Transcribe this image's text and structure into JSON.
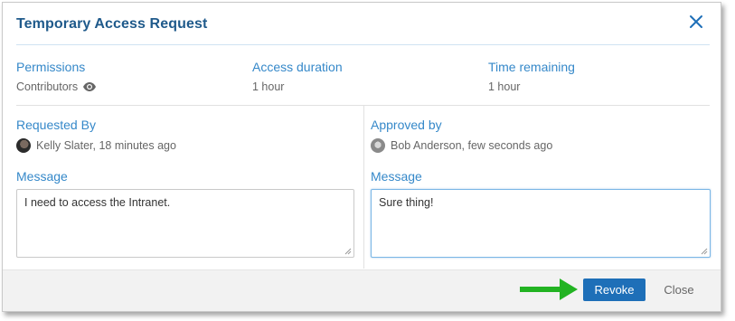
{
  "dialog": {
    "title": "Temporary Access Request",
    "close_icon": "close-icon"
  },
  "summary": {
    "permissions_label": "Permissions",
    "permissions_value": "Contributors",
    "access_duration_label": "Access duration",
    "access_duration_value": "1 hour",
    "time_remaining_label": "Time remaining",
    "time_remaining_value": "1 hour"
  },
  "requested": {
    "label": "Requested By",
    "value": "Kelly Slater, 18 minutes ago",
    "message_label": "Message",
    "message": "I need to access the Intranet."
  },
  "approved": {
    "label": "Approved by",
    "value": "Bob Anderson, few seconds ago",
    "message_label": "Message",
    "message": "Sure thing!"
  },
  "footer": {
    "revoke_label": "Revoke",
    "close_label": "Close"
  },
  "colors": {
    "accent": "#3588c9",
    "title": "#1f5a8b",
    "primary_button": "#1e6fb8",
    "arrow": "#22b322"
  }
}
